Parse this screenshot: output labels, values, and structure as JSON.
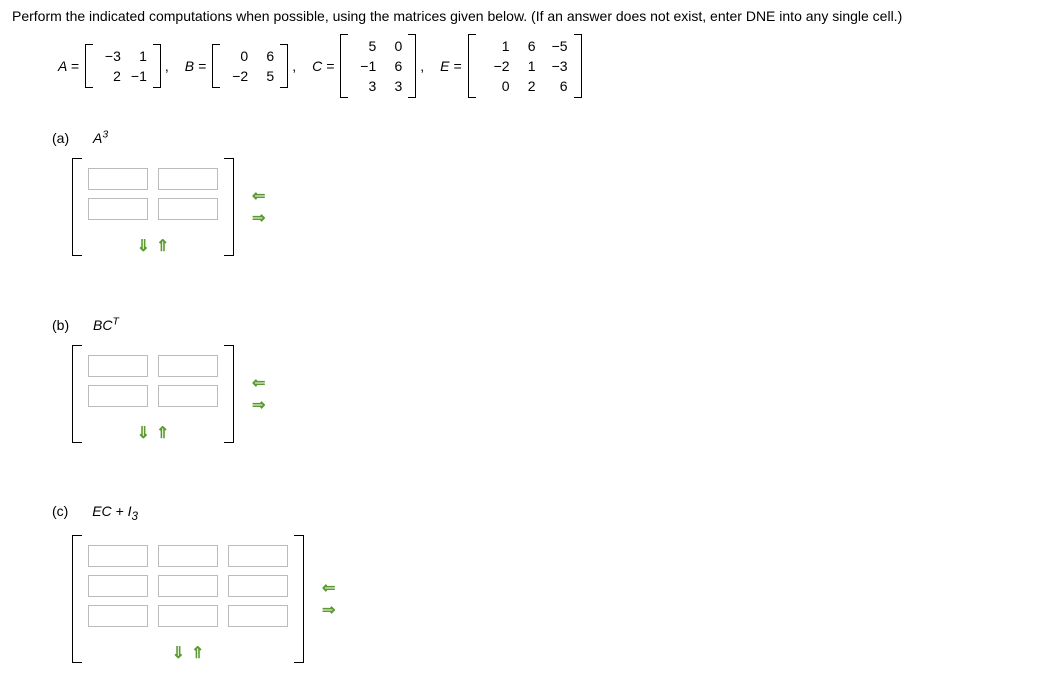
{
  "instruction": "Perform the indicated computations when possible, using the matrices given below. (If an answer does not exist, enter DNE into any single cell.)",
  "matrices": {
    "A": {
      "label": "A =",
      "rows": [
        [
          "−3",
          "1"
        ],
        [
          "2",
          "−1"
        ]
      ]
    },
    "B": {
      "label": "B =",
      "rows": [
        [
          "0",
          "6"
        ],
        [
          "−2",
          "5"
        ]
      ]
    },
    "C": {
      "label": "C =",
      "rows": [
        [
          "5",
          "0"
        ],
        [
          "−1",
          "6"
        ],
        [
          "3",
          "3"
        ]
      ]
    },
    "E": {
      "label": "E =",
      "rows": [
        [
          "1",
          "6",
          "−5"
        ],
        [
          "−2",
          "1",
          "−3"
        ],
        [
          "0",
          "2",
          "6"
        ]
      ]
    }
  },
  "comma": ",",
  "parts": {
    "a": {
      "label": "(a)",
      "expr": "A",
      "sup": "3"
    },
    "b": {
      "label": "(b)",
      "expr": "BC",
      "sup": "T"
    },
    "c": {
      "label": "(c)",
      "expr_full": "EC + I",
      "sub": "3"
    }
  },
  "arrows": {
    "left": "⇐",
    "right": "⇒",
    "down": "⇓",
    "up": "⇑"
  }
}
